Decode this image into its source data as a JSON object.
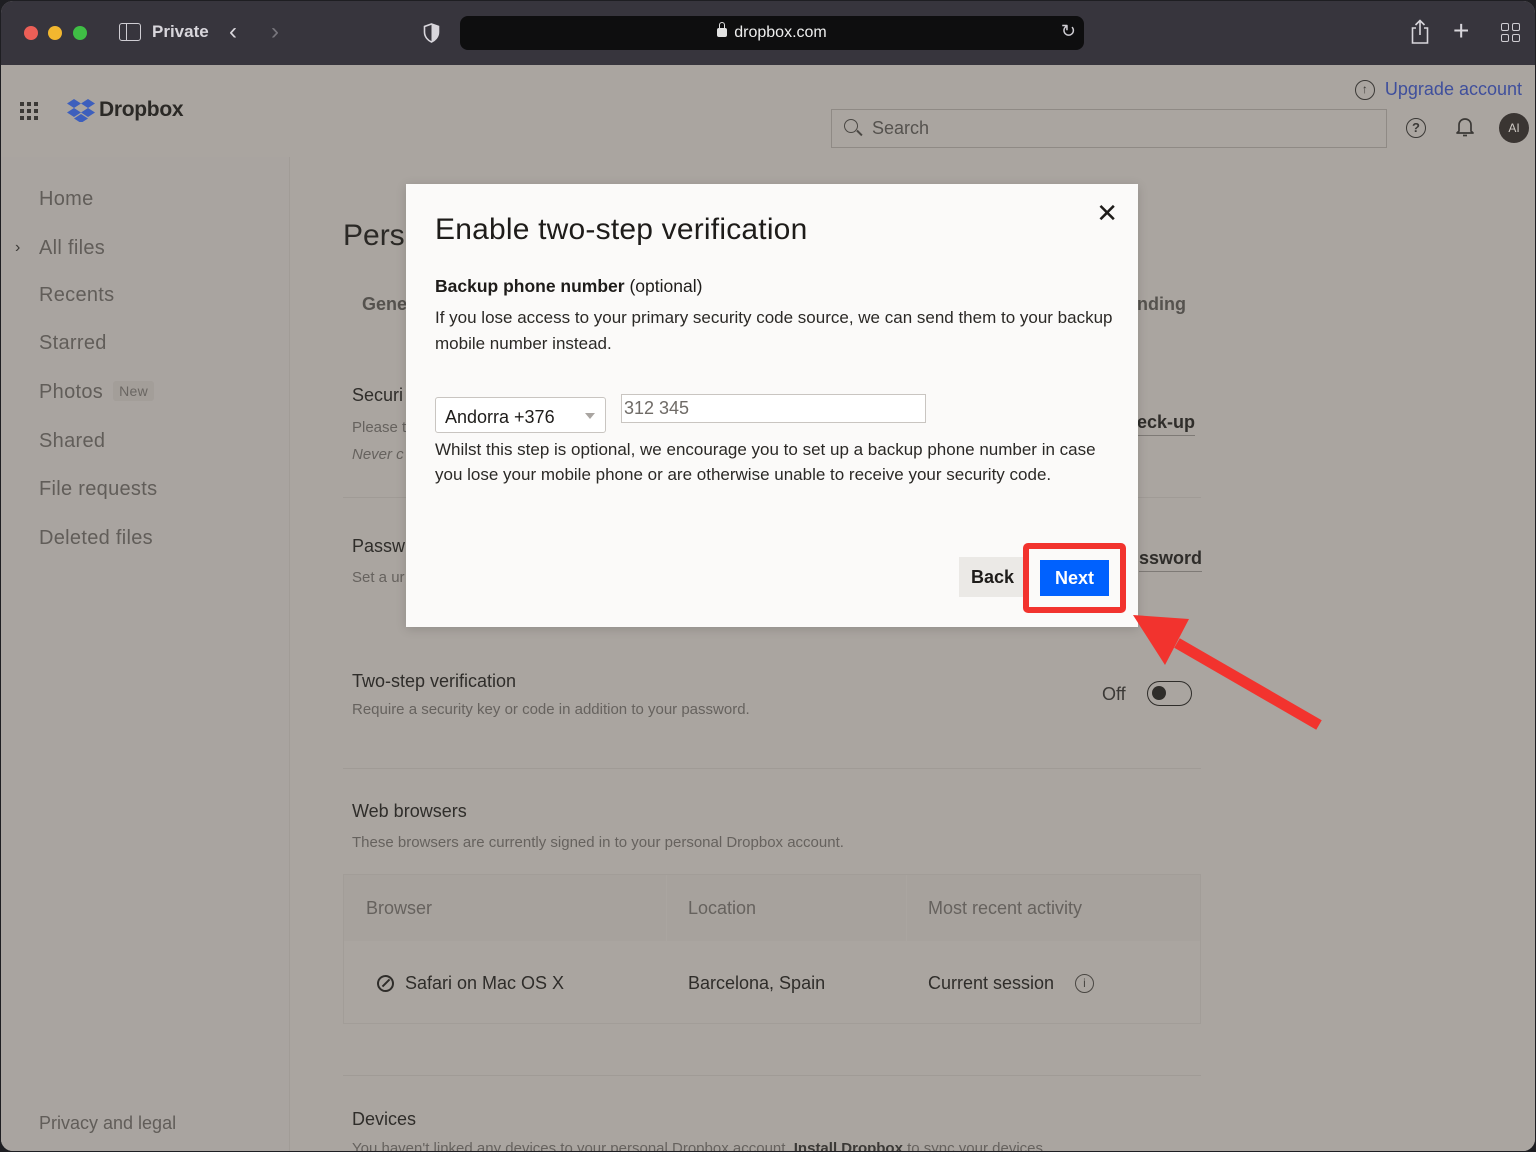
{
  "browser": {
    "mode_label": "Private",
    "url": "dropbox.com"
  },
  "header": {
    "logo_text": "Dropbox",
    "upgrade_label": "Upgrade account",
    "search_placeholder": "Search",
    "avatar_initials": "AI",
    "brand_color": "#0061fe"
  },
  "sidebar": {
    "items": [
      {
        "label": "Home"
      },
      {
        "label": "All files",
        "expandable": true
      },
      {
        "label": "Recents"
      },
      {
        "label": "Starred"
      },
      {
        "label": "Photos",
        "badge": "New"
      },
      {
        "label": "Shared"
      },
      {
        "label": "File requests"
      },
      {
        "label": "Deleted files"
      }
    ],
    "footer_link": "Privacy and legal"
  },
  "page": {
    "title_partial": "Pers",
    "tabs": {
      "general_partial": "Gene",
      "branding_partial": "anding"
    },
    "security_section": {
      "title_partial": "Securi",
      "desc_partial": "Please t",
      "note_partial": "Never c",
      "link_partial": "eck-up"
    },
    "password_section": {
      "title_partial": "Passw",
      "desc_partial": "Set a ur",
      "link_partial": "ssword"
    },
    "two_step": {
      "title": "Two-step verification",
      "desc": "Require a security key or code in addition to your password.",
      "state_label": "Off",
      "enabled": false
    },
    "web_browsers": {
      "title": "Web browsers",
      "desc": "These browsers are currently signed in to your personal Dropbox account.",
      "columns": [
        "Browser",
        "Location",
        "Most recent activity"
      ],
      "rows": [
        {
          "browser": "Safari on Mac OS X",
          "location": "Barcelona, Spain",
          "activity": "Current session"
        }
      ]
    },
    "devices": {
      "title": "Devices",
      "desc_prefix": "You haven't linked any devices to your personal Dropbox account.",
      "desc_link": "Install Dropbox",
      "desc_suffix": "to sync your devices."
    }
  },
  "modal": {
    "title": "Enable two-step verification",
    "label_bold": "Backup phone number",
    "label_suffix": "(optional)",
    "intro": "If you lose access to your primary security code source, we can send them to your backup mobile number instead.",
    "country_value": "Andorra +376",
    "phone_placeholder": "312 345",
    "note": "Whilst this step is optional, we encourage you to set up a backup phone number in case you lose your mobile phone or are otherwise unable to receive your security code.",
    "back_label": "Back",
    "next_label": "Next",
    "highlight_color": "#f2332e"
  }
}
